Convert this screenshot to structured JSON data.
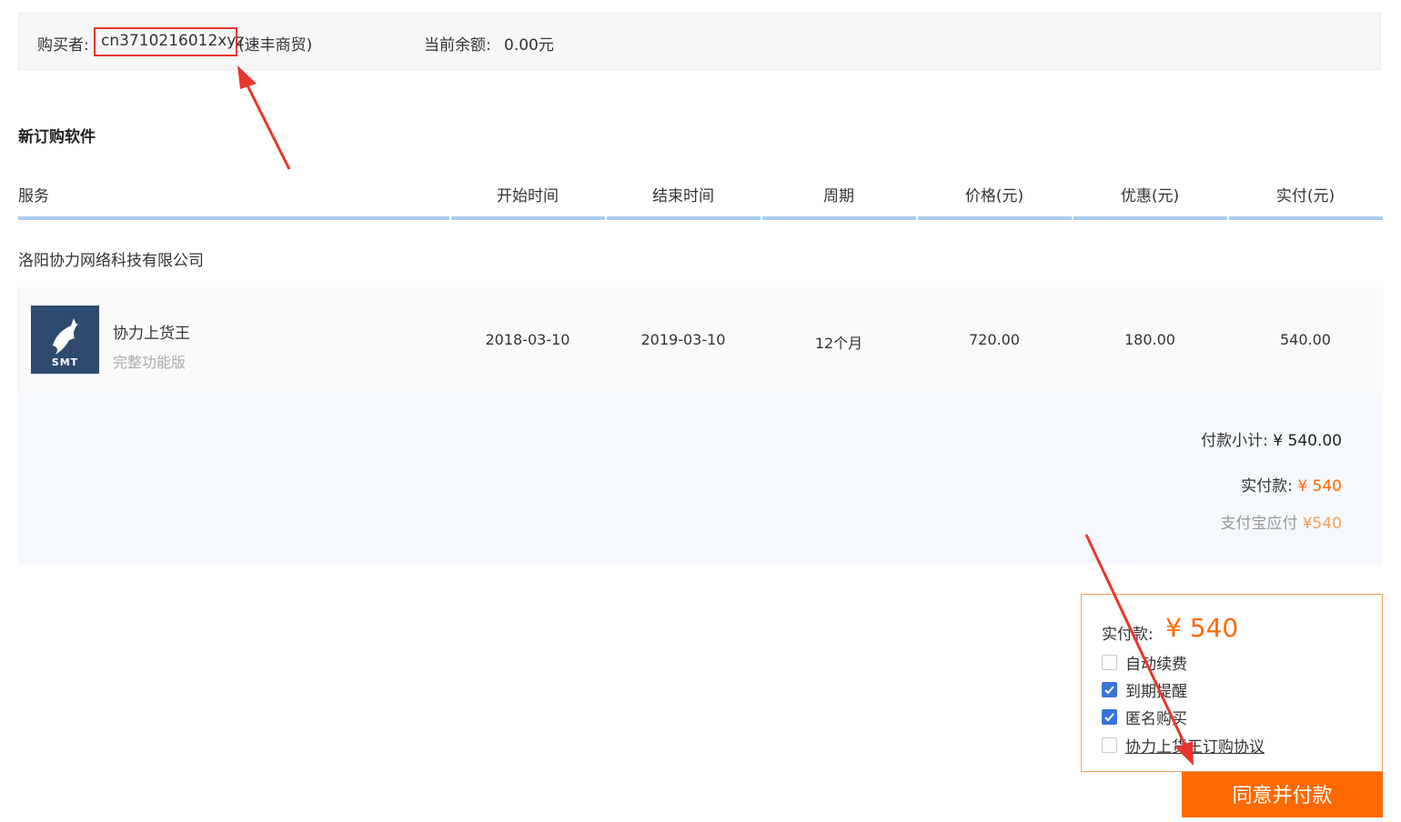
{
  "buyer": {
    "label": "购买者:",
    "id": "cn3710216012xyz",
    "company": "(速丰商贸)",
    "balance_label": "当前余额:",
    "balance_value": "0.00元"
  },
  "section_title": "新订购软件",
  "table": {
    "headers": [
      "服务",
      "开始时间",
      "结束时间",
      "周期",
      "价格(元)",
      "优惠(元)",
      "实付(元)"
    ],
    "vendor": "洛阳协力网络科技有限公司",
    "row": {
      "logo_text": "SMT",
      "name": "协力上货王",
      "edition": "完整功能版",
      "start": "2018-03-10",
      "end": "2019-03-10",
      "period": "12个月",
      "price": "720.00",
      "discount": "180.00",
      "paid": "540.00"
    }
  },
  "summary": {
    "subtotal_label": "付款小计:",
    "subtotal_value": "¥ 540.00",
    "actual_label": "实付款:",
    "actual_value": "¥ 540",
    "alipay_label": "支付宝应付",
    "alipay_value": "¥540"
  },
  "paybox": {
    "label": "实付款:",
    "amount": "¥ 540",
    "options": [
      {
        "label": "自动续费",
        "checked": false
      },
      {
        "label": "到期提醒",
        "checked": true
      },
      {
        "label": "匿名购买",
        "checked": true
      },
      {
        "label": "协力上货王订购协议",
        "checked": false
      }
    ],
    "button": "同意并付款"
  },
  "colors": {
    "accent": "#ff6a00",
    "highlight": "#e8352f",
    "header_line": "#a9cdf0",
    "logo_bg": "#2e4a6e",
    "checkbox": "#3a73d8"
  }
}
